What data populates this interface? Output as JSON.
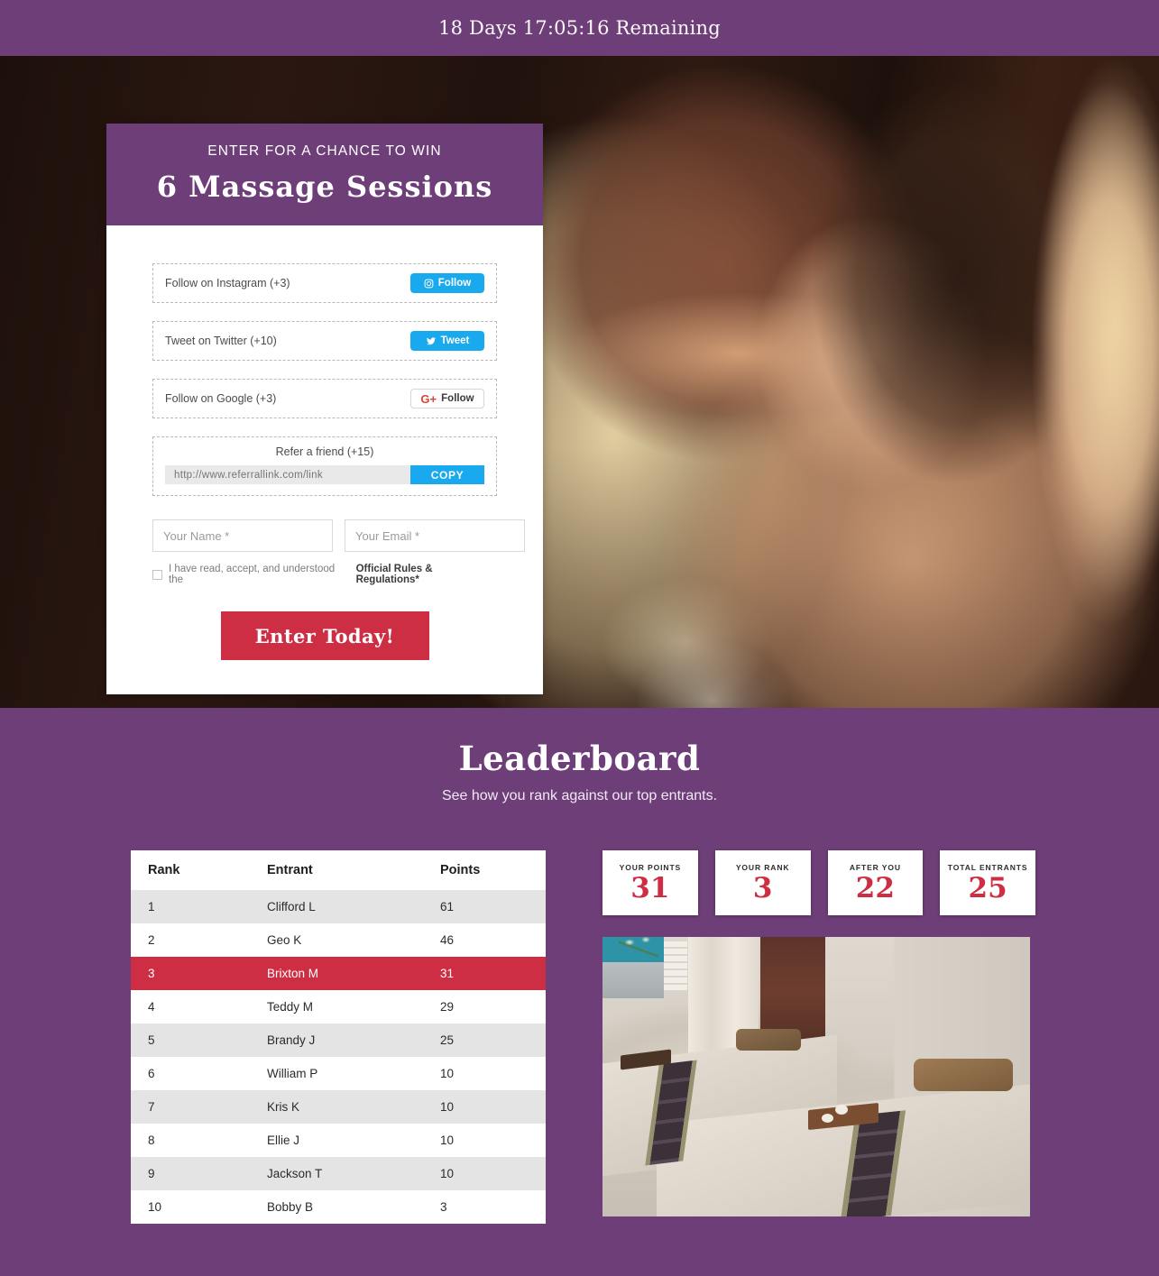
{
  "countdown": {
    "text": "18 Days 17:05:16 Remaining"
  },
  "entry": {
    "eyebrow": "ENTER FOR A CHANCE TO WIN",
    "title": "6 Massage Sessions",
    "actions": [
      {
        "label": "Follow on Instagram (+3)",
        "button": "Follow",
        "icon": "instagram-icon"
      },
      {
        "label": "Tweet on Twitter (+10)",
        "button": "Tweet",
        "icon": "twitter-icon"
      },
      {
        "label": "Follow on Google (+3)",
        "button": "Follow",
        "icon": "google-plus-icon",
        "prefix": "G+"
      }
    ],
    "refer": {
      "label": "Refer a friend (+15)",
      "link_placeholder": "http://www.referrallink.com/link",
      "copy_label": "COPY"
    },
    "name_placeholder": "Your Name *",
    "email_placeholder": "Your Email *",
    "consent_text": "I have read, accept, and understood the ",
    "consent_link": "Official Rules & Regulations*",
    "submit_label": "Enter Today!"
  },
  "leaderboard": {
    "title": "Leaderboard",
    "subtitle": "See how you rank against our top entrants.",
    "columns": [
      "Rank",
      "Entrant",
      "Points"
    ],
    "rows": [
      {
        "rank": "1",
        "entrant": "Clifford L",
        "points": "61",
        "highlight": false
      },
      {
        "rank": "2",
        "entrant": "Geo K",
        "points": "46",
        "highlight": false
      },
      {
        "rank": "3",
        "entrant": "Brixton M",
        "points": "31",
        "highlight": true
      },
      {
        "rank": "4",
        "entrant": "Teddy M",
        "points": "29",
        "highlight": false
      },
      {
        "rank": "5",
        "entrant": "Brandy J",
        "points": "25",
        "highlight": false
      },
      {
        "rank": "6",
        "entrant": "William P",
        "points": "10",
        "highlight": false
      },
      {
        "rank": "7",
        "entrant": "Kris K",
        "points": "10",
        "highlight": false
      },
      {
        "rank": "8",
        "entrant": "Ellie J",
        "points": "10",
        "highlight": false
      },
      {
        "rank": "9",
        "entrant": "Jackson T",
        "points": "10",
        "highlight": false
      },
      {
        "rank": "10",
        "entrant": "Bobby B",
        "points": "3",
        "highlight": false
      }
    ],
    "stats": [
      {
        "label": "YOUR POINTS",
        "value": "31"
      },
      {
        "label": "YOUR RANK",
        "value": "3"
      },
      {
        "label": "AFTER YOU",
        "value": "22"
      },
      {
        "label": "TOTAL ENTRANTS",
        "value": "25"
      }
    ]
  },
  "colors": {
    "purple": "#6e3e78",
    "crimson": "#ce2e43",
    "social_blue": "#18a9ef",
    "google_red": "#db4437"
  }
}
